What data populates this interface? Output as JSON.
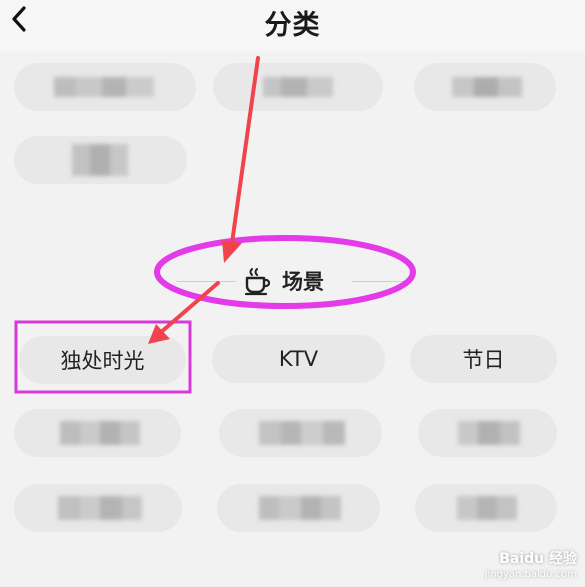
{
  "header": {
    "title": "分类",
    "back_icon": "chevron-left-icon"
  },
  "section": {
    "icon": "coffee-cup-icon",
    "label": "场景"
  },
  "scene_chips": [
    {
      "label": "独处时光"
    },
    {
      "label": "KTV"
    },
    {
      "label": "节日"
    }
  ],
  "annotations": {
    "arrow_color": "#f0434d",
    "circle_color": "#e43be8",
    "box_color": "#d63ad6"
  },
  "watermark": {
    "brand": "Baidu 经验",
    "url": "jingyan.baidu.com"
  }
}
